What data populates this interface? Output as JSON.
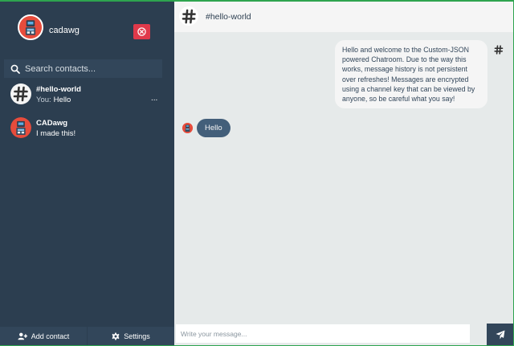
{
  "profile": {
    "username": "cadawg",
    "avatar_icon": "robot-avatar-icon",
    "logout_icon": "close-circle-icon"
  },
  "search": {
    "placeholder": "Search contacts...",
    "icon": "search-icon"
  },
  "contacts": [
    {
      "name": "#hello-world",
      "preview_prefix": "You:",
      "preview": "Hello",
      "more": "...",
      "avatar_icon": "hash-icon"
    },
    {
      "name": "CADawg",
      "preview": "I made this!",
      "avatar_icon": "robot-avatar-icon"
    }
  ],
  "bottom_bar": {
    "add_contact_label": "Add contact",
    "add_contact_icon": "user-plus-icon",
    "settings_label": "Settings",
    "settings_icon": "gear-icon"
  },
  "chat": {
    "title": "#hello-world",
    "header_icon": "hash-icon",
    "messages": [
      {
        "direction": "received",
        "text": "Hello and welcome to the Custom-JSON powered Chatroom. Due to the way this works, message history is not persistent over refreshes! Messages are encrypted using a channel key that can be viewed by anyone, so be careful what you say!"
      },
      {
        "direction": "sent",
        "text": "Hello"
      }
    ],
    "composer_placeholder": "Write your message...",
    "send_icon": "paper-plane-icon"
  },
  "colors": {
    "sidebar": "#2c3e50",
    "sidebar_panel": "#32465a",
    "chat_background": "#e6eaea",
    "sent_bubble": "#435f7a",
    "received_bubble": "#f5f5f5",
    "logout_button": "#e0394a",
    "frame_border": "#2ea44f"
  }
}
